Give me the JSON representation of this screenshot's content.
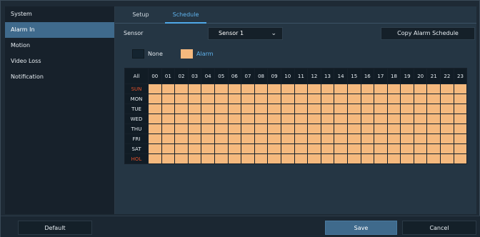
{
  "sidebar": {
    "items": [
      {
        "label": "System",
        "active": false
      },
      {
        "label": "Alarm In",
        "active": true
      },
      {
        "label": "Motion",
        "active": false
      },
      {
        "label": "Video Loss",
        "active": false
      },
      {
        "label": "Notification",
        "active": false
      }
    ]
  },
  "tabs": [
    {
      "label": "Setup",
      "active": false
    },
    {
      "label": "Schedule",
      "active": true
    }
  ],
  "sensor": {
    "label": "Sensor",
    "selected": "Sensor 1",
    "dropdown_icon": "chevron-down-icon"
  },
  "copy_button": "Copy Alarm Schedule",
  "legend": {
    "none_label": "None",
    "alarm_label": "Alarm",
    "none_color": "#142430",
    "alarm_color": "#f5b97e"
  },
  "schedule": {
    "all_label": "All",
    "hours": [
      "00",
      "01",
      "02",
      "03",
      "04",
      "05",
      "06",
      "07",
      "08",
      "09",
      "10",
      "11",
      "12",
      "13",
      "14",
      "15",
      "16",
      "17",
      "18",
      "19",
      "20",
      "21",
      "22",
      "23"
    ],
    "days": [
      {
        "label": "SUN",
        "weekend": true
      },
      {
        "label": "MON",
        "weekend": false
      },
      {
        "label": "TUE",
        "weekend": false
      },
      {
        "label": "WED",
        "weekend": false
      },
      {
        "label": "THU",
        "weekend": false
      },
      {
        "label": "FRI",
        "weekend": false
      },
      {
        "label": "SAT",
        "weekend": false
      },
      {
        "label": "HOL",
        "weekend": true
      }
    ],
    "cell_state": "alarm"
  },
  "footer": {
    "default_label": "Default",
    "save_label": "Save",
    "cancel_label": "Cancel"
  },
  "colors": {
    "accent": "#4fa8e8",
    "weekend": "#e0502a",
    "active_bg": "#3f6a8c"
  }
}
